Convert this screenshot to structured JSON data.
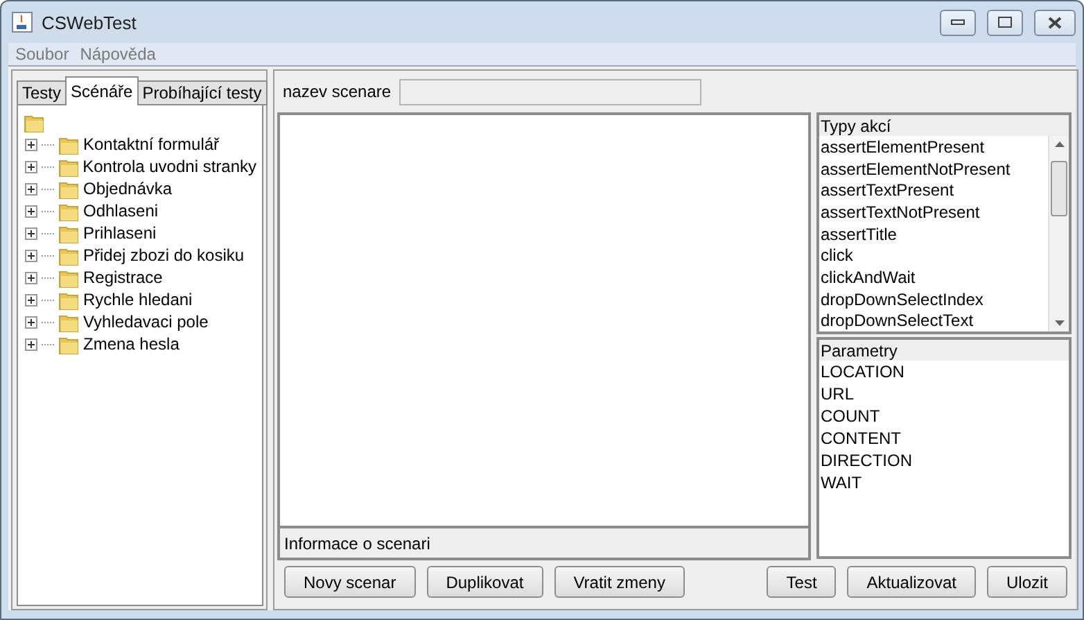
{
  "window": {
    "title": "CSWebTest"
  },
  "menu": [
    "Soubor",
    "Nápověda"
  ],
  "tabs": [
    {
      "label": "Testy",
      "selected": false
    },
    {
      "label": "Scénáře",
      "selected": true
    },
    {
      "label": "Probíhající testy",
      "selected": false
    }
  ],
  "tree": {
    "children": [
      {
        "label": "Kontaktní formulář",
        "expanded": false
      },
      {
        "label": "Kontrola uvodni stranky",
        "expanded": false
      },
      {
        "label": "Objednávka",
        "expanded": false
      },
      {
        "label": "Odhlaseni",
        "expanded": false
      },
      {
        "label": "Prihlaseni",
        "expanded": false
      },
      {
        "label": "Přidej zbozi do kosiku",
        "expanded": false
      },
      {
        "label": "Registrace",
        "expanded": false
      },
      {
        "label": "Rychle hledani",
        "expanded": false
      },
      {
        "label": "Vyhledavaci pole",
        "expanded": false
      },
      {
        "label": "Zmena hesla",
        "expanded": false
      }
    ]
  },
  "name_field": {
    "label": "nazev scenare"
  },
  "info_label": "Informace o scenari",
  "actions": {
    "header": "Typy akcí",
    "items": [
      "assertElementPresent",
      "assertElementNotPresent",
      "assertTextPresent",
      "assertTextNotPresent",
      "assertTitle",
      "click",
      "clickAndWait",
      "dropDownSelectIndex",
      "dropDownSelectText"
    ]
  },
  "parameters": {
    "header": "Parametry",
    "items": [
      "LOCATION",
      "URL",
      "COUNT",
      "CONTENT",
      "DIRECTION",
      "WAIT"
    ]
  },
  "buttons_left": [
    "Novy scenar",
    "Duplikovat",
    "Vratit zmeny"
  ],
  "buttons_right": [
    "Test",
    "Aktualizovat",
    "Ulozit"
  ]
}
